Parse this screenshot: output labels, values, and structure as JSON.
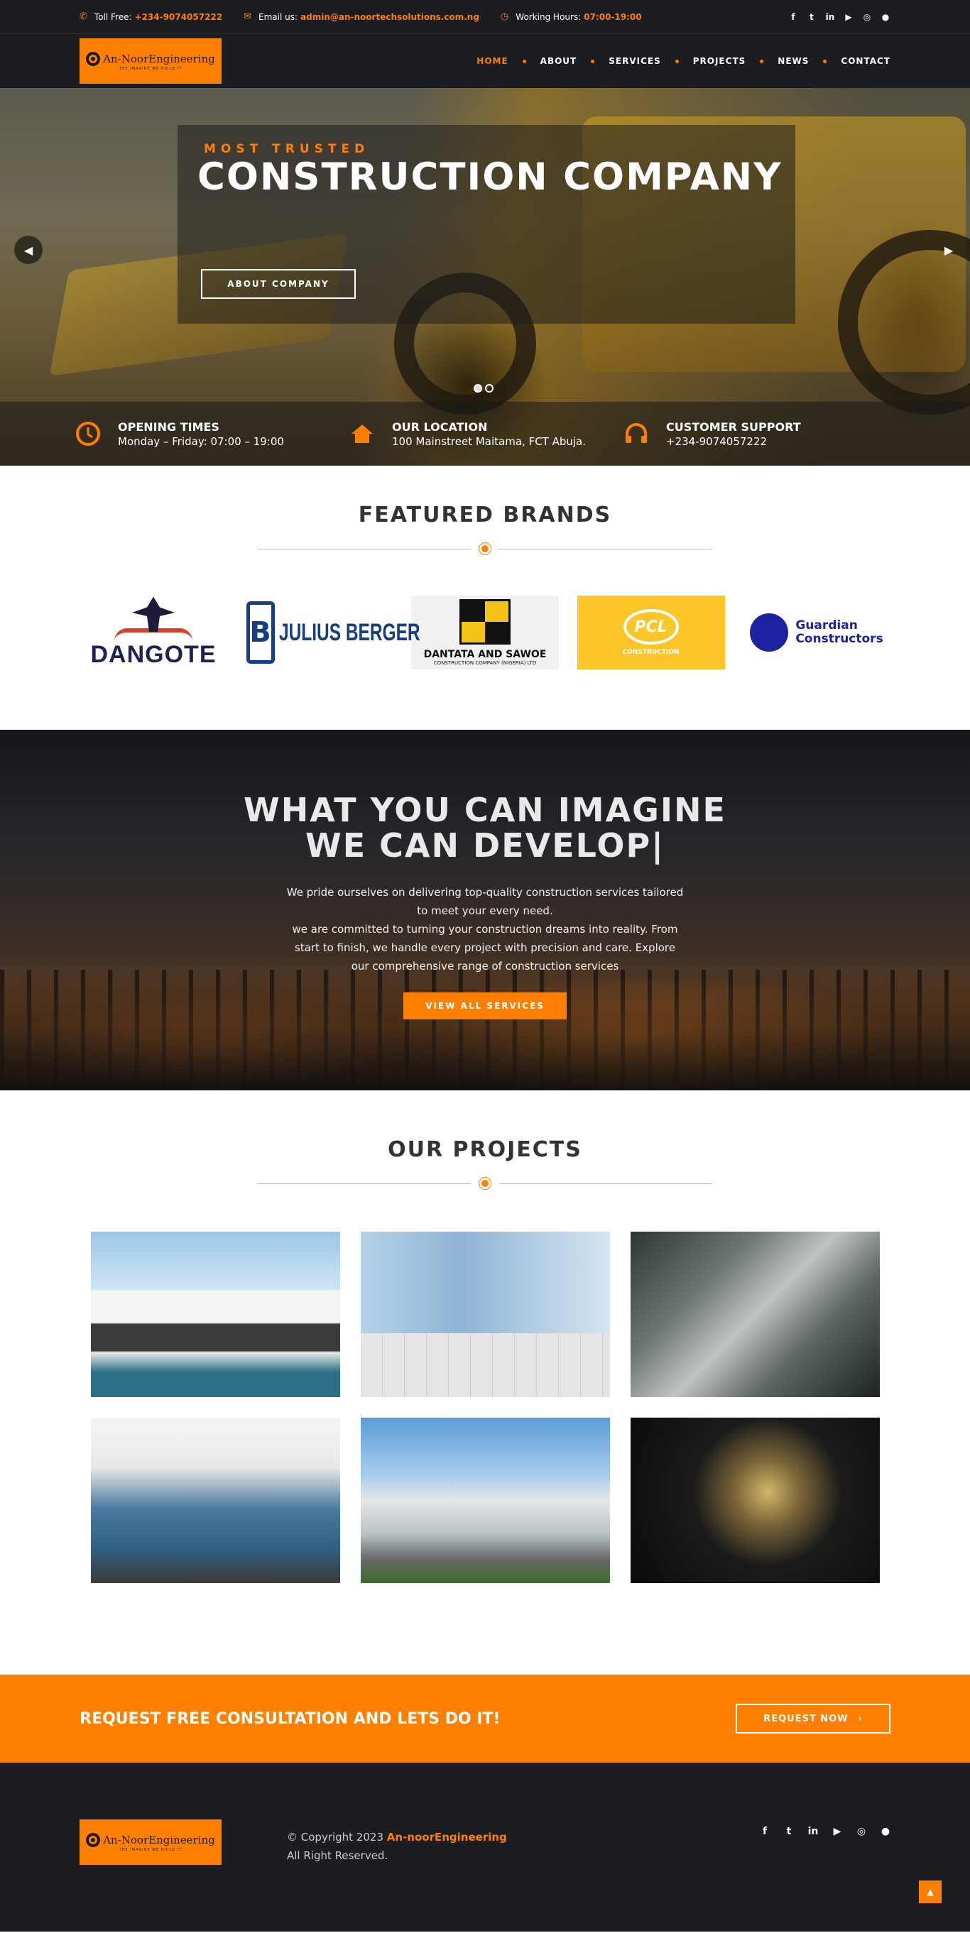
{
  "topbar": {
    "toll_label": "Toll Free:",
    "toll_value": "+234-9074057222",
    "email_label": "Email us:",
    "email_value": "admin@an-noortechsolutions.com.ng",
    "hours_label": "Working Hours:",
    "hours_value": "07:00-19:00",
    "socials": [
      "facebook",
      "twitter",
      "linkedin",
      "youtube",
      "instagram",
      "github"
    ]
  },
  "logo": {
    "name": "An-NoorEngineering",
    "tagline": "THE IMAGINE WE BUILD IT"
  },
  "nav": {
    "items": [
      "HOME",
      "ABOUT",
      "SERVICES",
      "PROJECTS",
      "NEWS",
      "CONTACT"
    ],
    "active": "HOME"
  },
  "hero": {
    "eyebrow": "MOST TRUSTED",
    "title": "CONSTRUCTION COMPANY",
    "button": "ABOUT COMPANY",
    "prev_icon": "chevron-left-icon",
    "next_icon": "chevron-right-icon",
    "info": [
      {
        "icon": "clock-icon",
        "title": "OPENING TIMES",
        "text": "Monday – Friday: 07:00 – 19:00"
      },
      {
        "icon": "home-icon",
        "title": "OUR LOCATION",
        "text": "100 Mainstreet Maitama, FCT Abuja."
      },
      {
        "icon": "headset-icon",
        "title": "CUSTOMER SUPPORT",
        "text": "+234-9074057222"
      }
    ]
  },
  "brands": {
    "title": "FEATURED BRANDS",
    "items": [
      {
        "name": "DANGOTE"
      },
      {
        "name": "JULIUS BERGER",
        "letter": "B"
      },
      {
        "name": "DANTATA AND SAWOE",
        "sub": "CONSTRUCTION COMPANY (NIGERIA) LTD"
      },
      {
        "name": "PCL",
        "sub": "CONSTRUCTION"
      },
      {
        "name1": "Guardian",
        "name2": "Constructors"
      }
    ]
  },
  "imagine": {
    "line1": "WHAT YOU CAN IMAGINE",
    "line2": "WE CAN DEVELOP|",
    "p1": "We pride ourselves on delivering top-quality construction services tailored to meet your every need.",
    "p2": "we are committed to turning your construction dreams into reality. From start to finish, we handle every project with precision and care. Explore our comprehensive range of construction services",
    "button": "VIEW ALL SERVICES"
  },
  "projects": {
    "title": "OUR PROJECTS",
    "items": [
      "modern-villa",
      "glass-office-tower",
      "industrial-pipes",
      "glass-building",
      "warehouse",
      "engine-part"
    ]
  },
  "consult": {
    "text": "REQUEST FREE CONSULTATION AND LETS DO IT!",
    "button": "REQUEST NOW"
  },
  "footer": {
    "copy_prefix": "© Copyright 2023",
    "brand": "An-noorEngineering",
    "rights": "All Right Reserved."
  },
  "colors": {
    "accent": "#ff7f00",
    "dark": "#1b1d22"
  }
}
